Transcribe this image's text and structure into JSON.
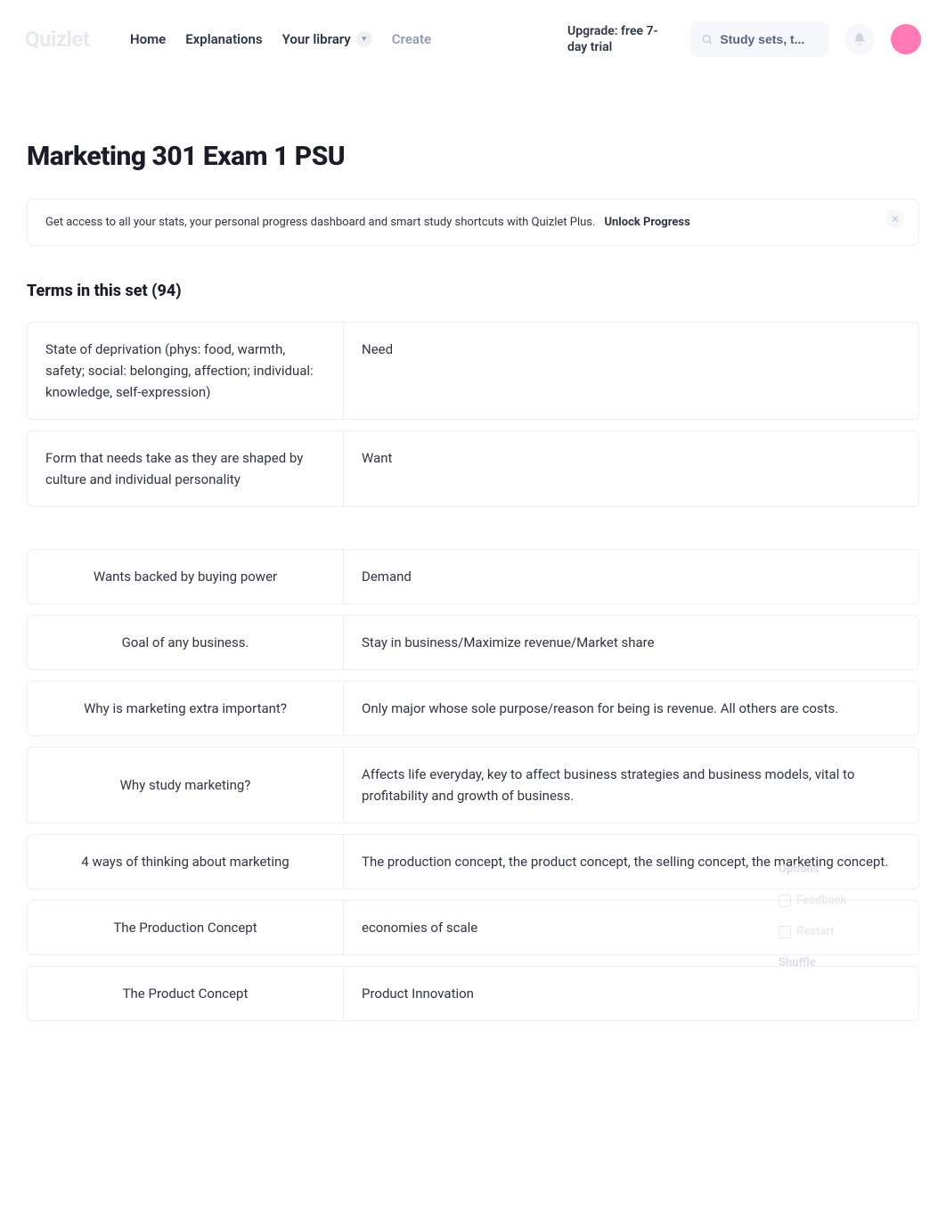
{
  "nav": {
    "logo": "Quizlet",
    "home": "Home",
    "explanations": "Explanations",
    "library": "Your library",
    "create": "Create",
    "upgrade": "Upgrade: free 7-day trial"
  },
  "search": {
    "placeholder": "Study sets, t..."
  },
  "page_title": "Marketing 301 Exam 1 PSU",
  "banner": {
    "text": "Get access to all your stats, your personal progress dashboard and smart study shortcuts with Quizlet Plus.",
    "link": "Unlock Progress"
  },
  "section_title": "Terms in this set (94)",
  "terms_group1": [
    {
      "left": "State of deprivation (phys: food, warmth, safety; social: belonging, affection; individual: knowledge, self-expression)",
      "right": "Need"
    },
    {
      "left": "Form that needs take as they are shaped by culture and individual personality",
      "right": "Want"
    }
  ],
  "terms_group2": [
    {
      "left": "Wants backed by buying power",
      "right": "Demand"
    },
    {
      "left": "Goal of any business.",
      "right": "Stay in business/Maximize revenue/Market share"
    },
    {
      "left": "Why is marketing extra important?",
      "right": "Only major whose sole purpose/reason for being is revenue. All others are costs."
    },
    {
      "left": "Why study marketing?",
      "right": "Affects life everyday, key to affect business strategies and business models, vital to profitability and growth of business."
    },
    {
      "left": "4 ways of thinking about marketing",
      "right": "The production concept, the product concept, the selling concept, the marketing concept."
    },
    {
      "left": "The Production Concept",
      "right": "economies of scale"
    },
    {
      "left": "The Product Concept",
      "right": "Product Innovation"
    }
  ],
  "side_widget": {
    "label1": "Options",
    "label2": "Feedback",
    "label3": "Restart",
    "label4": "Shuffle"
  }
}
